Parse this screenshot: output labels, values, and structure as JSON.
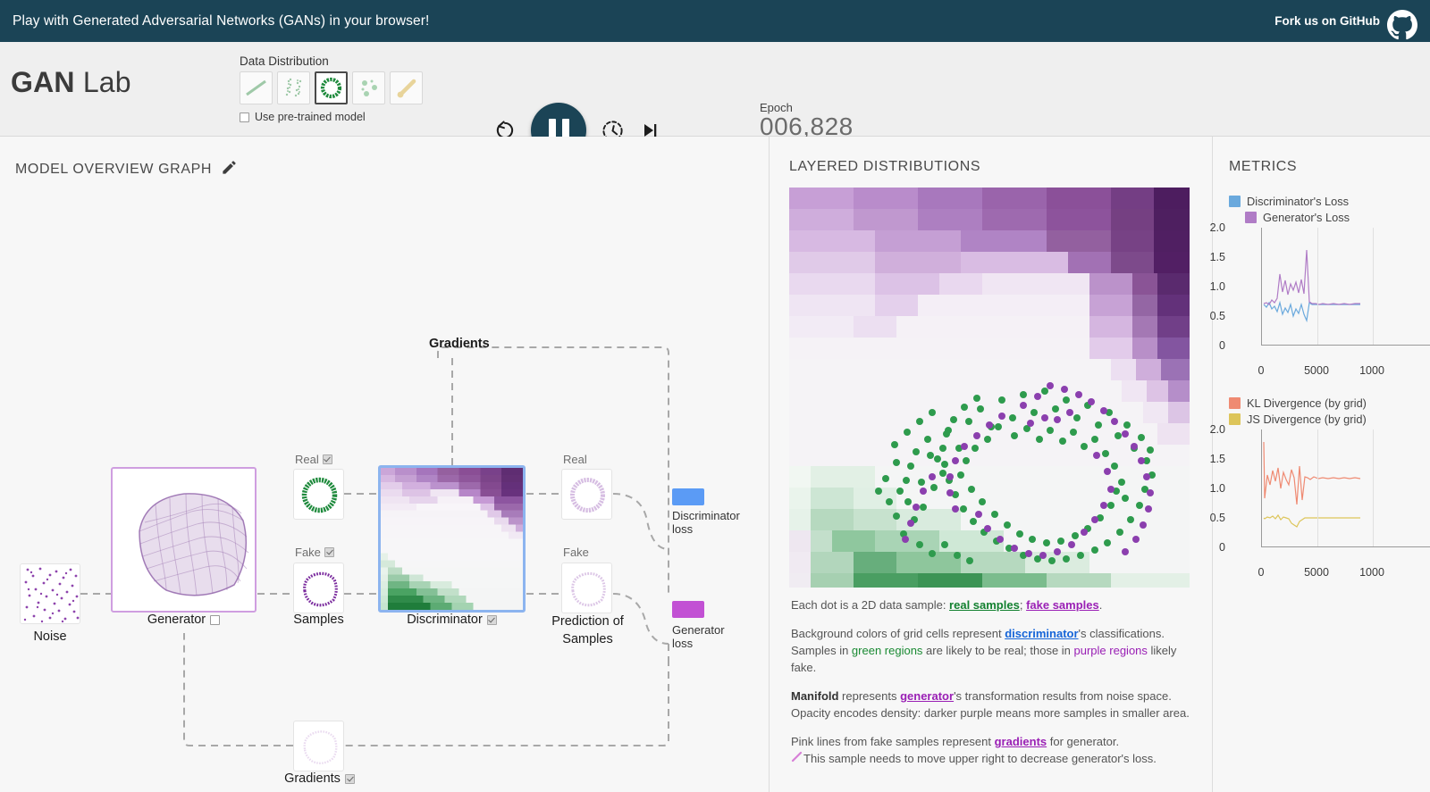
{
  "banner": {
    "title": "Play with Generated Adversarial Networks (GANs) in your browser!",
    "github_label": "Fork us on GitHub",
    "bg_color": "#1b4456"
  },
  "toolbar": {
    "logo_bold": "GAN",
    "logo_light": "Lab",
    "data_distribution_label": "Data Distribution",
    "distributions": [
      {
        "name": "line",
        "selected": false
      },
      {
        "name": "two-gaussian-clusters",
        "selected": false
      },
      {
        "name": "ring",
        "selected": true
      },
      {
        "name": "three-blobs",
        "selected": false
      },
      {
        "name": "draw-your-own",
        "selected": false
      }
    ],
    "pretrained_label": "Use pre-trained model",
    "pretrained_checked": false,
    "controls": [
      {
        "name": "reset",
        "label": "Reset"
      },
      {
        "name": "play-pause",
        "label": "Pause",
        "state": "playing"
      },
      {
        "name": "slow-step",
        "label": "Step slowly"
      },
      {
        "name": "step",
        "label": "Step"
      }
    ],
    "epoch_label": "Epoch",
    "epoch_value": "006,828"
  },
  "model_overview": {
    "title": "MODEL OVERVIEW GRAPH",
    "edit_icon": "pencil-icon",
    "gradients_header": "Gradients",
    "nodes": {
      "noise": {
        "caption": "Noise"
      },
      "generator": {
        "caption": "Generator",
        "checkbox": false
      },
      "real_samples": {
        "top_label": "Real",
        "checkbox": true
      },
      "fake_samples": {
        "top_label": "Fake",
        "checkbox": true,
        "caption": "Samples"
      },
      "discriminator": {
        "caption": "Discriminator",
        "checkbox": true
      },
      "pred_real": {
        "top_label": "Real"
      },
      "pred_fake": {
        "top_label": "Fake",
        "caption": "Prediction of\nSamples"
      },
      "gradients": {
        "caption": "Gradients",
        "checkbox": true
      }
    },
    "losses": [
      {
        "name": "discriminator-loss",
        "label_line1": "Discriminator",
        "label_line2": "loss",
        "color": "#5b9bf5"
      },
      {
        "name": "generator-loss",
        "label_line1": "Generator",
        "label_line2": "loss",
        "color": "#c251d4"
      }
    ]
  },
  "layered_distributions": {
    "title": "LAYERED DISTRIBUTIONS",
    "caption": {
      "line1_prefix": "Each dot is a 2D data sample: ",
      "line1_real": "real samples",
      "line1_sep": "; ",
      "line1_fake": "fake samples",
      "line1_suffix": ".",
      "line2a_prefix": "Background colors of grid cells represent ",
      "line2a_link": "discriminator",
      "line2a_suffix": "'s classifications.",
      "line2b_prefix": "Samples in ",
      "line2b_green": "green regions",
      "line2b_mid": " are likely to be real; those in ",
      "line2b_purple": "purple regions",
      "line2b_suffix": " likely fake.",
      "line3a_bold": "Manifold",
      "line3a_mid": " represents ",
      "line3a_link": "generator",
      "line3a_suffix": "'s transformation results from noise space.",
      "line3b": "Opacity encodes density: darker purple means more samples in smaller area.",
      "line4a_prefix": "Pink lines from fake samples represent ",
      "line4a_link": "gradients",
      "line4a_suffix": " for generator.",
      "line4b": "This sample needs to move upper right to decrease generator's loss."
    }
  },
  "metrics": {
    "title": "METRICS",
    "colors": {
      "discriminator_loss": "#6aa9dd",
      "generator_loss": "#b07cc6",
      "kl_divergence": "#ef8a72",
      "js_divergence": "#ddc55a"
    }
  },
  "chart_data": [
    {
      "type": "line",
      "title": "Losses",
      "xlabel": "",
      "ylabel": "",
      "xlim": [
        0,
        10000
      ],
      "ylim": [
        0,
        2.0
      ],
      "yticks": [
        "2.0",
        "1.5",
        "1.0",
        "0.5",
        "0"
      ],
      "xticks": [
        "0",
        "5000",
        "1000"
      ],
      "grid": true,
      "legend_position": "top",
      "series": [
        {
          "name": "Discriminator's Loss",
          "color": "#6aa9dd",
          "x": [
            0,
            200,
            400,
            600,
            800,
            1000,
            1200,
            1400,
            1600,
            1800,
            2000,
            2200,
            2400,
            2600,
            2800,
            3000,
            3200,
            3400,
            3600,
            4000,
            4500,
            5000,
            5500,
            6000,
            6400,
            6828
          ],
          "values": [
            0.7,
            0.68,
            0.66,
            0.69,
            0.64,
            0.62,
            0.68,
            0.6,
            0.66,
            0.63,
            0.69,
            0.61,
            0.67,
            0.64,
            0.7,
            0.62,
            0.58,
            0.72,
            0.69,
            0.69,
            0.69,
            0.69,
            0.69,
            0.69,
            0.69,
            0.69
          ]
        },
        {
          "name": "Generator's Loss",
          "color": "#b07cc6",
          "x": [
            0,
            200,
            400,
            600,
            800,
            1000,
            1200,
            1400,
            1600,
            1800,
            2000,
            2200,
            2400,
            2600,
            2800,
            3000,
            3200,
            3400,
            3600,
            4000,
            4500,
            5000,
            5500,
            6000,
            6400,
            6828
          ],
          "values": [
            0.72,
            0.74,
            0.71,
            0.78,
            0.73,
            0.8,
            1.22,
            0.92,
            1.1,
            0.86,
            1.05,
            0.95,
            1.08,
            0.9,
            1.12,
            0.88,
            1.62,
            0.75,
            0.72,
            0.72,
            0.71,
            0.72,
            0.71,
            0.72,
            0.71,
            0.72
          ]
        }
      ]
    },
    {
      "type": "line",
      "title": "Divergences",
      "xlabel": "",
      "ylabel": "",
      "xlim": [
        0,
        10000
      ],
      "ylim": [
        0,
        2.0
      ],
      "yticks": [
        "2.0",
        "1.5",
        "1.0",
        "0.5",
        "0"
      ],
      "xticks": [
        "0",
        "5000",
        "1000"
      ],
      "grid": true,
      "legend_position": "top",
      "series": [
        {
          "name": "KL Divergence (by grid)",
          "color": "#ef8a72",
          "x": [
            0,
            100,
            300,
            500,
            700,
            900,
            1100,
            1300,
            1500,
            1700,
            1900,
            2100,
            2300,
            2500,
            2700,
            2900,
            3100,
            3300,
            3500,
            3800,
            4200,
            4600,
            5000,
            5500,
            6000,
            6400,
            6828
          ],
          "values": [
            1.78,
            0.85,
            1.22,
            1.05,
            1.3,
            1.12,
            1.35,
            1.0,
            1.28,
            1.15,
            1.05,
            1.32,
            1.18,
            0.72,
            1.38,
            0.8,
            1.2,
            1.18,
            1.15,
            1.2,
            1.16,
            1.18,
            1.16,
            1.18,
            1.17,
            1.19,
            1.18
          ]
        },
        {
          "name": "JS Divergence (by grid)",
          "color": "#ddc55a",
          "x": [
            0,
            100,
            300,
            500,
            700,
            900,
            1100,
            1300,
            1500,
            1700,
            1900,
            2100,
            2300,
            2500,
            2700,
            2900,
            3100,
            3300,
            3500,
            3800,
            4200,
            4600,
            5000,
            5500,
            6000,
            6400,
            6828
          ],
          "values": [
            0.5,
            0.49,
            0.51,
            0.5,
            0.52,
            0.49,
            0.53,
            0.48,
            0.51,
            0.5,
            0.49,
            0.44,
            0.42,
            0.4,
            0.46,
            0.48,
            0.5,
            0.5,
            0.5,
            0.5,
            0.5,
            0.5,
            0.5,
            0.5,
            0.5,
            0.5,
            0.5
          ]
        }
      ]
    }
  ]
}
